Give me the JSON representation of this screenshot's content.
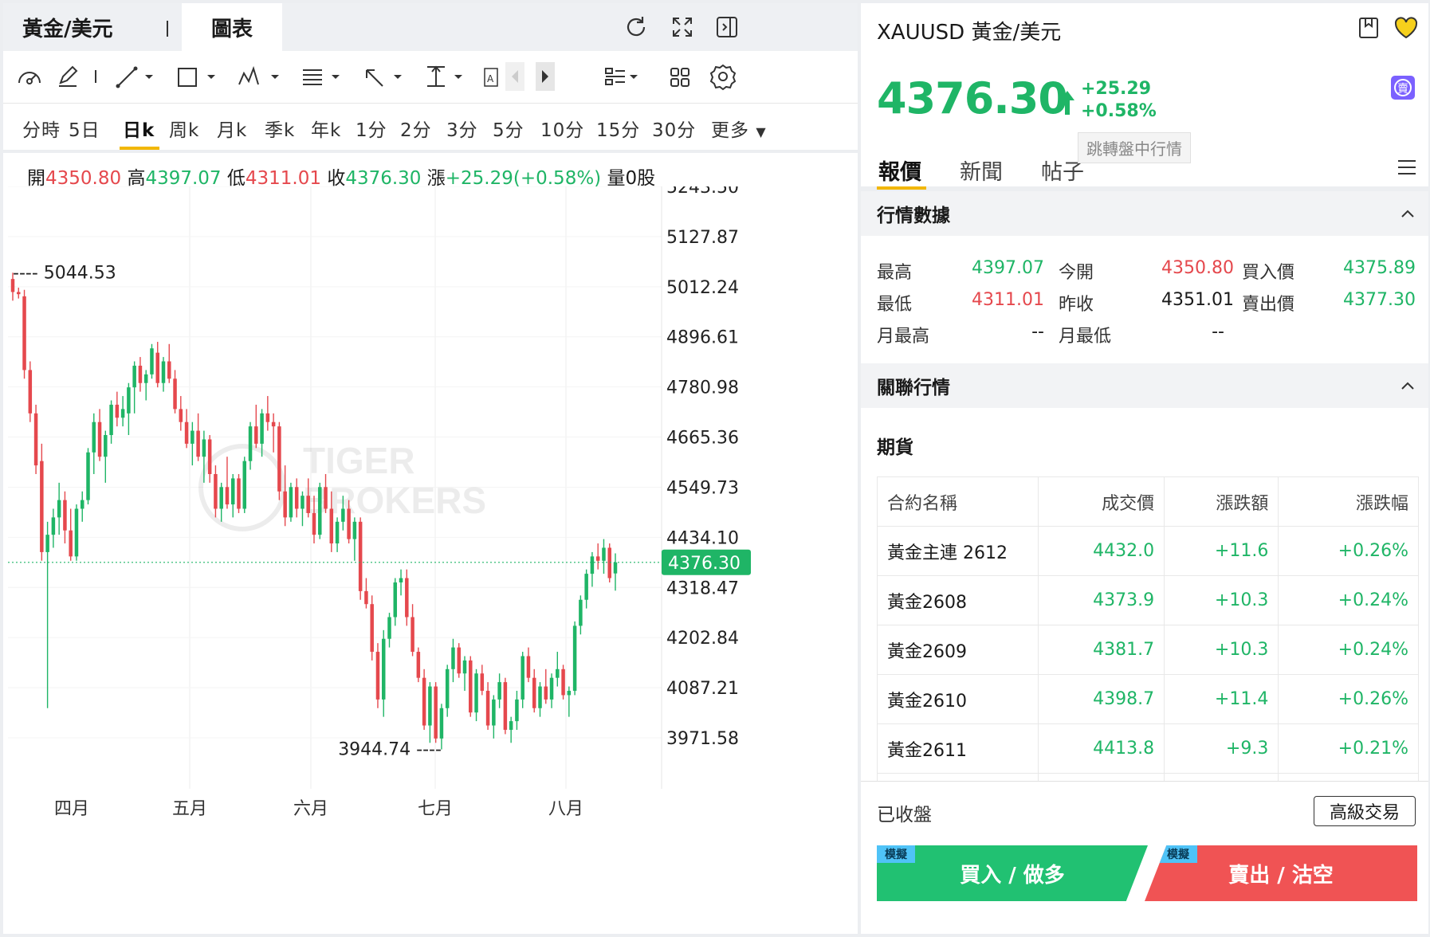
{
  "header": {
    "tab_symbol": "黃金/美元",
    "tab_chart": "圖表"
  },
  "periods": [
    "分時",
    "5日",
    "日k",
    "周k",
    "月k",
    "季k",
    "年k",
    "1分",
    "2分",
    "3分",
    "5分",
    "10分",
    "15分",
    "30分",
    "更多"
  ],
  "active_period": "日k",
  "ohlc": {
    "open_label": "開",
    "open": "4350.80",
    "high_label": "高",
    "high": "4397.07",
    "low_label": "低",
    "low": "4311.01",
    "close_label": "收",
    "close": "4376.30",
    "change_label": "漲",
    "change": "+25.29(+0.58%)",
    "volume_label": "量",
    "volume": "0股"
  },
  "chart_data": {
    "type": "candlestick",
    "y_ticks": [
      5243.5,
      5127.87,
      5012.24,
      4896.61,
      4780.98,
      4665.36,
      4549.73,
      4434.1,
      4318.47,
      4202.84,
      4087.21,
      3971.58
    ],
    "ylim": [
      3900,
      5290
    ],
    "x_ticks": [
      "四月",
      "五月",
      "六月",
      "七月",
      "八月"
    ],
    "current_price": "4376.30",
    "max_marker": "5044.53",
    "min_marker": "3944.74",
    "watermark": [
      "TIGER",
      "BROKERS"
    ],
    "candles": [
      [
        5030,
        5044.53,
        4980,
        5000
      ],
      [
        5000,
        5010,
        4985,
        4995
      ],
      [
        4990,
        5005,
        4800,
        4820
      ],
      [
        4820,
        4840,
        4700,
        4720
      ],
      [
        4720,
        4740,
        4580,
        4600
      ],
      [
        4610,
        4650,
        4380,
        4400
      ],
      [
        4400,
        4470,
        4040,
        4440
      ],
      [
        4440,
        4500,
        4410,
        4480
      ],
      [
        4480,
        4560,
        4440,
        4520
      ],
      [
        4520,
        4540,
        4420,
        4450
      ],
      [
        4450,
        4500,
        4380,
        4390
      ],
      [
        4390,
        4510,
        4380,
        4500
      ],
      [
        4500,
        4540,
        4470,
        4520
      ],
      [
        4520,
        4640,
        4510,
        4630
      ],
      [
        4630,
        4720,
        4580,
        4700
      ],
      [
        4700,
        4730,
        4610,
        4620
      ],
      [
        4620,
        4680,
        4560,
        4670
      ],
      [
        4670,
        4750,
        4650,
        4740
      ],
      [
        4740,
        4770,
        4690,
        4710
      ],
      [
        4710,
        4760,
        4690,
        4730
      ],
      [
        4720,
        4790,
        4670,
        4780
      ],
      [
        4780,
        4840,
        4720,
        4830
      ],
      [
        4830,
        4850,
        4770,
        4790
      ],
      [
        4790,
        4820,
        4750,
        4810
      ],
      [
        4810,
        4880,
        4800,
        4870
      ],
      [
        4860,
        4885,
        4780,
        4790
      ],
      [
        4790,
        4850,
        4770,
        4840
      ],
      [
        4840,
        4880,
        4790,
        4800
      ],
      [
        4800,
        4820,
        4720,
        4730
      ],
      [
        4730,
        4760,
        4680,
        4700
      ],
      [
        4700,
        4730,
        4640,
        4650
      ],
      [
        4650,
        4700,
        4600,
        4680
      ],
      [
        4680,
        4720,
        4610,
        4620
      ],
      [
        4620,
        4680,
        4560,
        4660
      ],
      [
        4660,
        4670,
        4560,
        4580
      ],
      [
        4580,
        4600,
        4480,
        4500
      ],
      [
        4500,
        4560,
        4470,
        4550
      ],
      [
        4550,
        4620,
        4500,
        4510
      ],
      [
        4510,
        4580,
        4480,
        4570
      ],
      [
        4570,
        4580,
        4490,
        4500
      ],
      [
        4500,
        4620,
        4490,
        4610
      ],
      [
        4610,
        4700,
        4590,
        4690
      ],
      [
        4690,
        4740,
        4640,
        4650
      ],
      [
        4650,
        4730,
        4620,
        4720
      ],
      [
        4720,
        4760,
        4680,
        4700
      ],
      [
        4700,
        4720,
        4630,
        4690
      ],
      [
        4690,
        4700,
        4520,
        4540
      ],
      [
        4540,
        4600,
        4460,
        4480
      ],
      [
        4480,
        4560,
        4470,
        4550
      ],
      [
        4550,
        4570,
        4480,
        4500
      ],
      [
        4500,
        4540,
        4460,
        4530
      ],
      [
        4530,
        4570,
        4480,
        4490
      ],
      [
        4490,
        4530,
        4420,
        4440
      ],
      [
        4440,
        4560,
        4430,
        4550
      ],
      [
        4550,
        4580,
        4490,
        4500
      ],
      [
        4500,
        4540,
        4400,
        4420
      ],
      [
        4420,
        4480,
        4400,
        4470
      ],
      [
        4470,
        4530,
        4450,
        4500
      ],
      [
        4500,
        4520,
        4420,
        4430
      ],
      [
        4430,
        4480,
        4380,
        4470
      ],
      [
        4470,
        4480,
        4290,
        4310
      ],
      [
        4310,
        4340,
        4270,
        4280
      ],
      [
        4280,
        4300,
        4150,
        4170
      ],
      [
        4170,
        4190,
        4040,
        4060
      ],
      [
        4060,
        4220,
        4020,
        4200
      ],
      [
        4200,
        4260,
        4180,
        4250
      ],
      [
        4250,
        4340,
        4230,
        4330
      ],
      [
        4330,
        4360,
        4300,
        4340
      ],
      [
        4340,
        4360,
        4230,
        4250
      ],
      [
        4250,
        4280,
        4160,
        4170
      ],
      [
        4170,
        4180,
        4100,
        4110
      ],
      [
        4110,
        4130,
        3990,
        4000
      ],
      [
        4000,
        4100,
        3960,
        4090
      ],
      [
        4090,
        4100,
        3960,
        3970
      ],
      [
        3970,
        4050,
        3944.74,
        4040
      ],
      [
        4040,
        4140,
        4020,
        4130
      ],
      [
        4130,
        4200,
        4100,
        4180
      ],
      [
        4180,
        4190,
        4110,
        4120
      ],
      [
        4120,
        4160,
        4080,
        4150
      ],
      [
        4150,
        4160,
        4020,
        4030
      ],
      [
        4030,
        4130,
        4010,
        4120
      ],
      [
        4120,
        4140,
        4070,
        4080
      ],
      [
        4080,
        4100,
        3990,
        4000
      ],
      [
        4000,
        4070,
        3970,
        4060
      ],
      [
        4060,
        4120,
        4040,
        4100
      ],
      [
        4100,
        4110,
        3980,
        3990
      ],
      [
        3990,
        4020,
        3960,
        4010
      ],
      [
        4010,
        4080,
        3990,
        4060
      ],
      [
        4060,
        4170,
        4040,
        4160
      ],
      [
        4160,
        4180,
        4100,
        4110
      ],
      [
        4110,
        4130,
        4030,
        4040
      ],
      [
        4040,
        4100,
        4020,
        4090
      ],
      [
        4090,
        4130,
        4050,
        4060
      ],
      [
        4060,
        4120,
        4040,
        4110
      ],
      [
        4110,
        4170,
        4090,
        4130
      ],
      [
        4130,
        4140,
        4060,
        4070
      ],
      [
        4070,
        4090,
        4020,
        4080
      ],
      [
        4080,
        4240,
        4070,
        4230
      ],
      [
        4230,
        4300,
        4210,
        4290
      ],
      [
        4290,
        4360,
        4270,
        4350
      ],
      [
        4350,
        4400,
        4320,
        4390
      ],
      [
        4390,
        4420,
        4360,
        4380
      ],
      [
        4380,
        4430,
        4350,
        4410
      ],
      [
        4410,
        4420,
        4330,
        4340
      ],
      [
        4350.8,
        4397.07,
        4311.01,
        4376.3
      ]
    ]
  },
  "right": {
    "title": "XAUUSD 黃金/美元",
    "price": "4376.30",
    "change": "+25.29",
    "change_pct": "+0.58%",
    "tooltip": "跳轉盤中行情",
    "tabs": [
      "報價",
      "新聞",
      "帖子"
    ],
    "market_section": "行情數據",
    "quote": {
      "high_label": "最高",
      "high": "4397.07",
      "open_label": "今開",
      "open": "4350.80",
      "bid_label": "買入價",
      "bid": "4375.89",
      "low_label": "最低",
      "low": "4311.01",
      "prev_label": "昨收",
      "prev": "4351.01",
      "ask_label": "賣出價",
      "ask": "4377.30",
      "month_high_label": "月最高",
      "month_high": "--",
      "month_low_label": "月最低",
      "month_low": "--"
    },
    "related_section": "關聯行情",
    "futures_title": "期貨",
    "futures_headers": [
      "合約名稱",
      "成交價",
      "漲跌額",
      "漲跌幅"
    ],
    "futures": [
      [
        "黃金主連 2612",
        "4432.0",
        "+11.6",
        "+0.26%"
      ],
      [
        "黃金2608",
        "4373.9",
        "+10.3",
        "+0.24%"
      ],
      [
        "黃金2609",
        "4381.7",
        "+10.3",
        "+0.24%"
      ],
      [
        "黃金2610",
        "4398.7",
        "+11.4",
        "+0.26%"
      ],
      [
        "黃金2611",
        "4413.8",
        "+9.3",
        "+0.21%"
      ]
    ],
    "status": "已收盤",
    "advanced_trade": "高級交易",
    "buy_label": "買入 / 做多",
    "sell_label": "賣出 / 沽空",
    "sim_badge": "模擬"
  },
  "colors": {
    "up": "#1fb566",
    "down": "#e5484d",
    "accent": "#f2b705",
    "buy": "#21c172",
    "sell": "#f05354"
  }
}
